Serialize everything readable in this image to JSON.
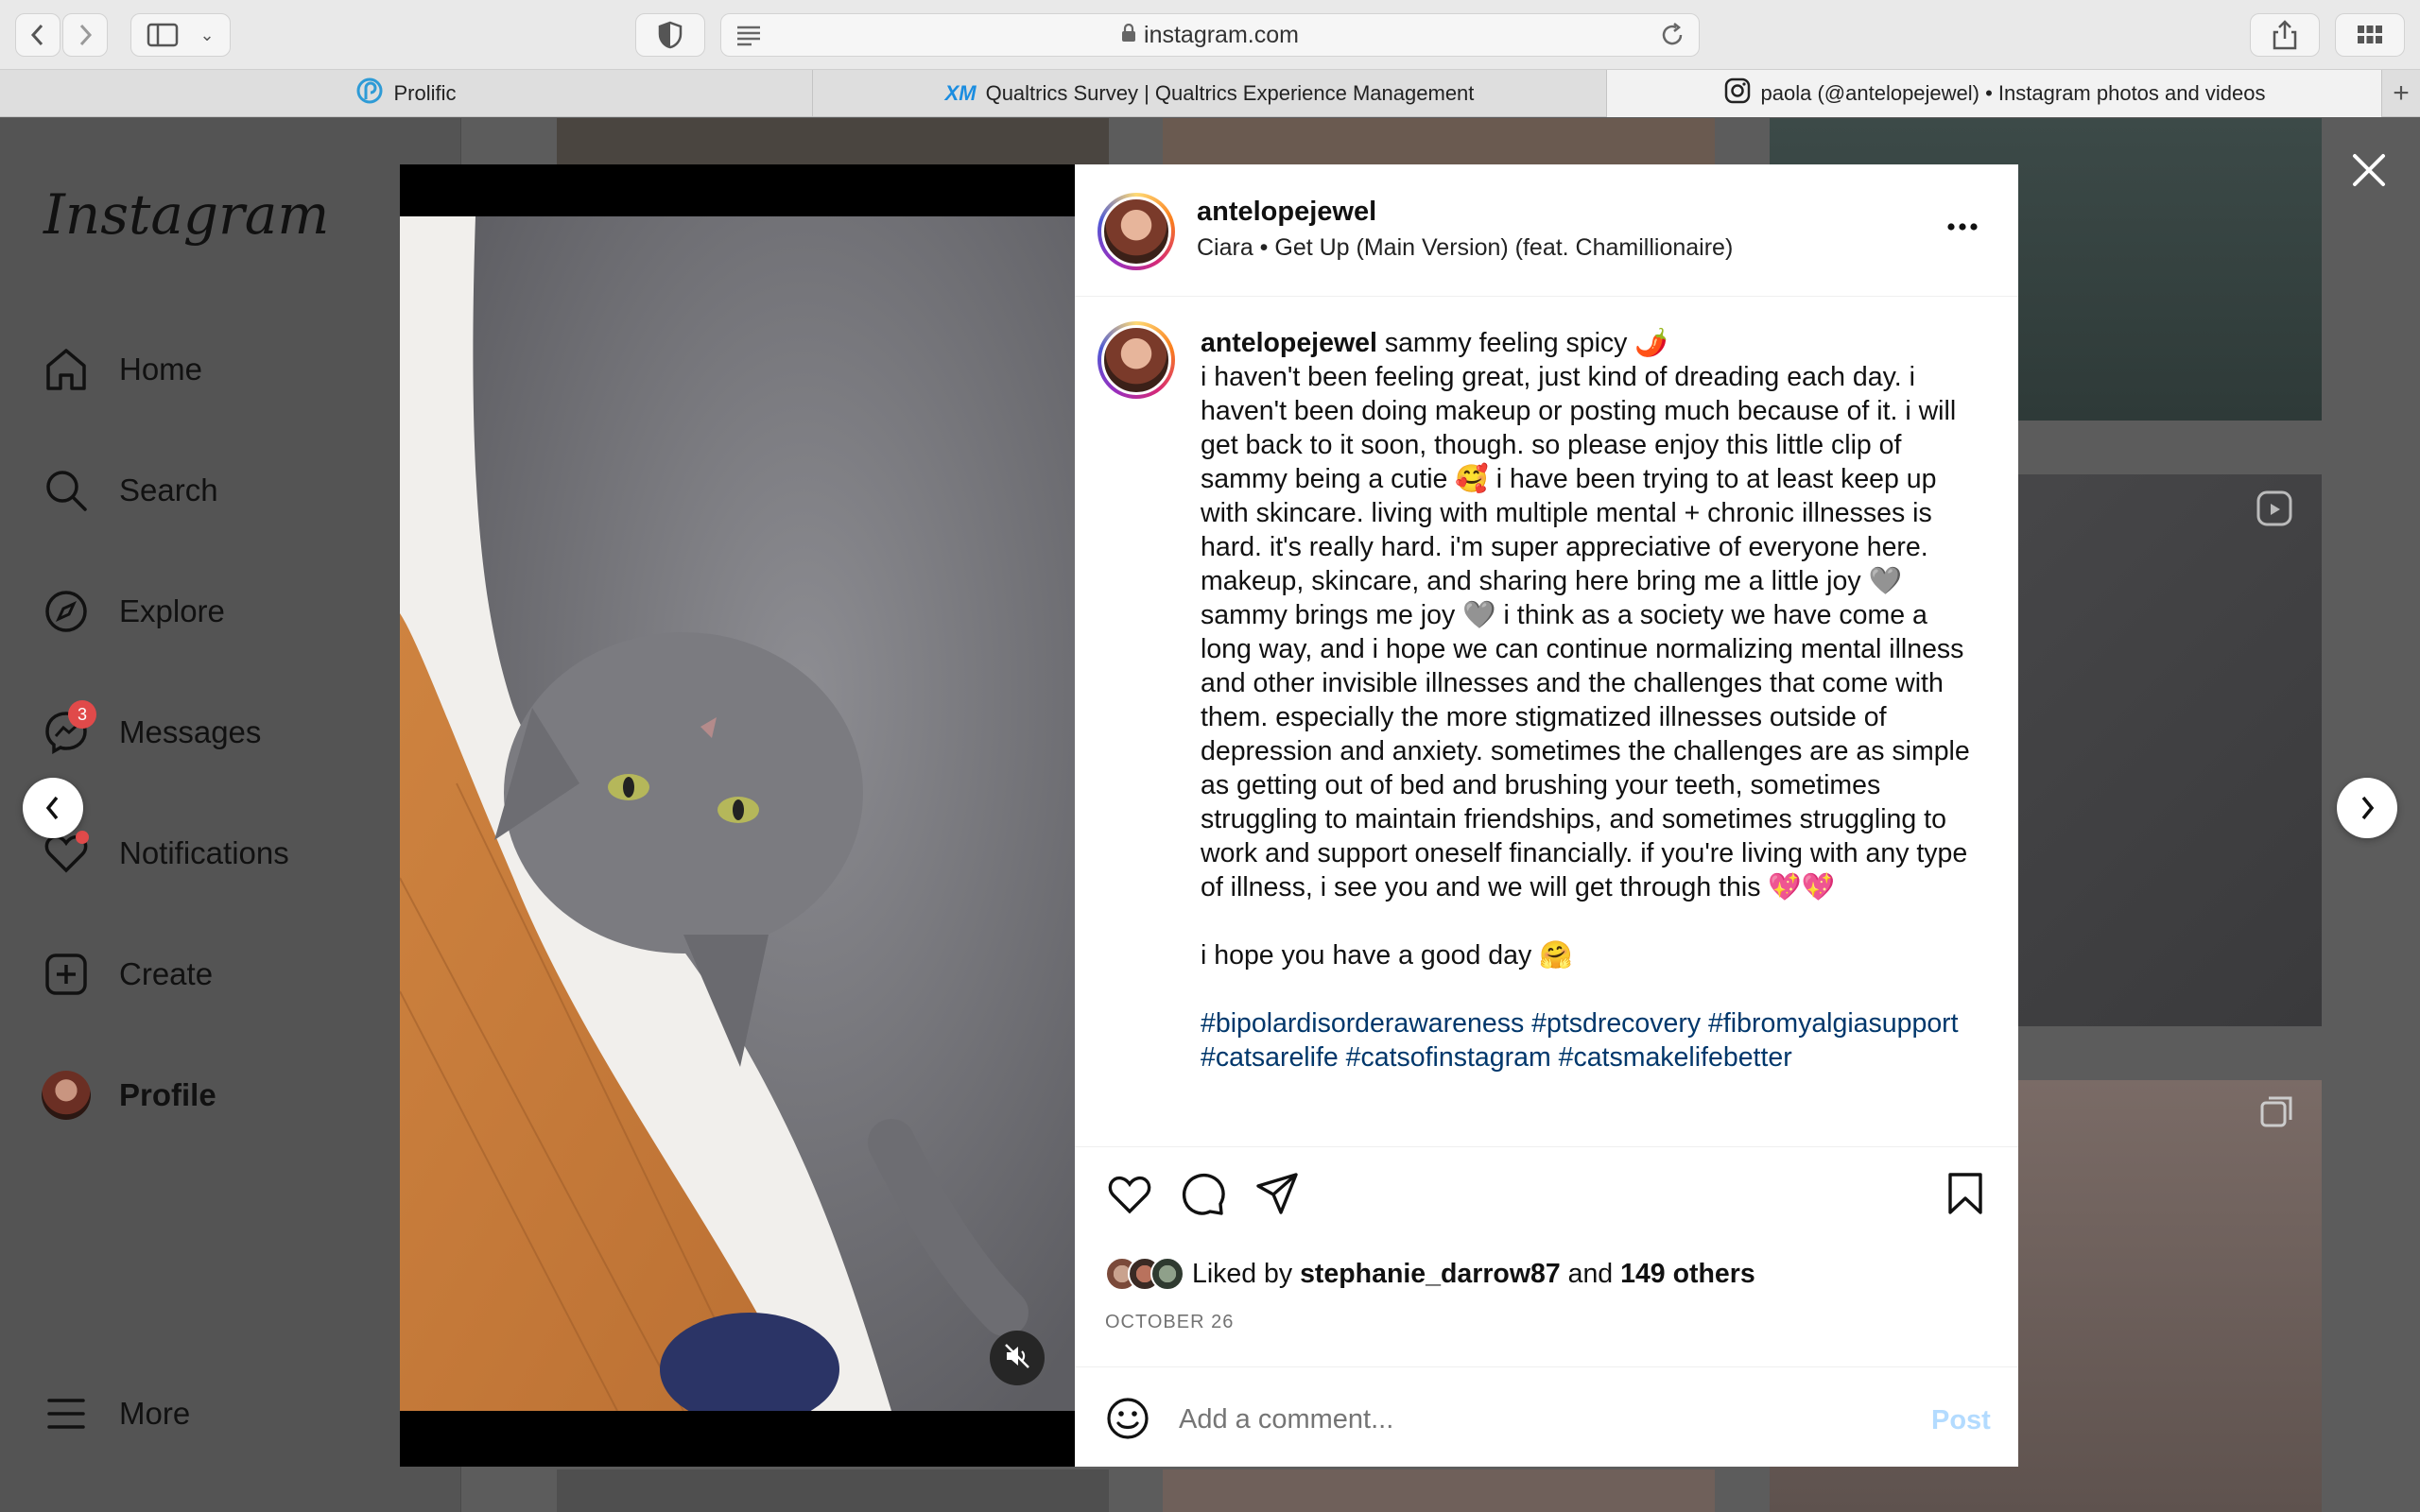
{
  "browser": {
    "url": "instagram.com"
  },
  "tabs": [
    {
      "label": "Prolific"
    },
    {
      "label": "Qualtrics Survey | Qualtrics Experience Management"
    },
    {
      "label": "paola (@antelopejewel) • Instagram photos and videos"
    }
  ],
  "sidebar": {
    "logo": "Instagram",
    "items": [
      {
        "label": "Home",
        "icon": "home-icon"
      },
      {
        "label": "Search",
        "icon": "search-icon"
      },
      {
        "label": "Explore",
        "icon": "compass-icon"
      },
      {
        "label": "Messages",
        "icon": "messenger-icon",
        "badge": "3"
      },
      {
        "label": "Notifications",
        "icon": "heart-icon"
      },
      {
        "label": "Create",
        "icon": "plus-square-icon"
      },
      {
        "label": "Profile",
        "icon": "avatar"
      },
      {
        "label": "More",
        "icon": "menu-icon"
      }
    ]
  },
  "post": {
    "username": "antelopejewel",
    "audio": "Ciara • Get Up (Main Version) (feat. Chamillionaire)",
    "caption_first": "sammy feeling spicy 🌶️",
    "caption_body": "i haven't been feeling great, just kind of dreading each day. i haven't been doing makeup or posting much because of it. i will get back to it soon, though. so please enjoy this little clip of sammy being a cutie 🥰 i have been trying to at least keep up with skincare. living with multiple mental + chronic illnesses is hard. it's really hard. i'm super appreciative of everyone here. makeup, skincare, and sharing here bring me a little joy 🩶 sammy brings me joy 🩶 i think as a society we have come a long way, and i hope we can continue normalizing mental illness and other invisible illnesses and the challenges that come with them. especially the more stigmatized illnesses outside of depression and anxiety. sometimes the challenges are as simple as getting out of bed and brushing your teeth, sometimes struggling to maintain friendships, and sometimes struggling to work and support oneself financially. if you're living with any type of illness, i see you and we will get through this 💖💖",
    "caption_end": "i hope you have a good day 🤗",
    "hashtags": "#bipolardisorderawareness #ptsdrecovery #fibromyalgiasupport #catsarelife #catsofinstagram #catsmakelifebetter",
    "likes_prefix": "Liked by",
    "liked_by": "stephanie_darrow87",
    "likes_and": "and",
    "likes_others": "149 others",
    "date": "OCTOBER 26",
    "comment_placeholder": "Add a comment...",
    "post_button": "Post"
  },
  "colors": {
    "accent": "#0095f6",
    "link": "#00376b",
    "notification": "#e04a4a"
  }
}
